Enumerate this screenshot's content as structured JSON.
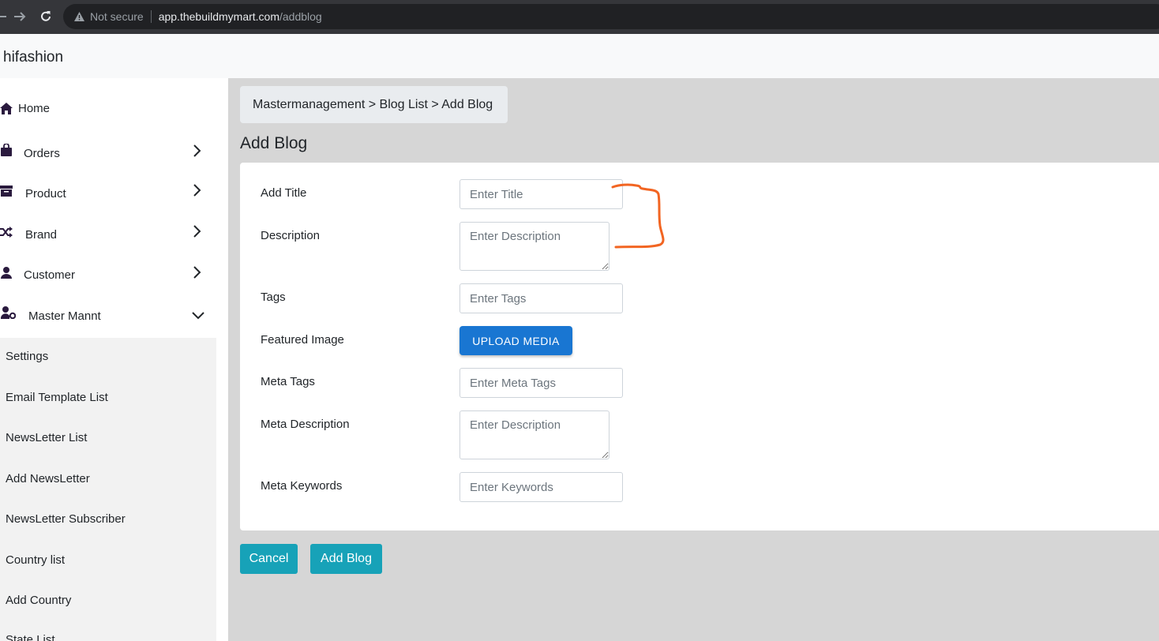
{
  "browser": {
    "security_label": "Not secure",
    "url_host": "app.thebuildmymart.com",
    "url_path": "/addblog"
  },
  "app": {
    "brand": "hifashion"
  },
  "sidebar": {
    "items": [
      {
        "label": "Home",
        "icon": "home-icon"
      },
      {
        "label": "Orders",
        "icon": "shopping-bag-icon"
      },
      {
        "label": "Product",
        "icon": "archive-box-icon"
      },
      {
        "label": "Brand",
        "icon": "shuffle-icon"
      },
      {
        "label": "Customer",
        "icon": "user-icon"
      },
      {
        "label": "Master Mannt",
        "icon": "user-gear-icon"
      }
    ],
    "submenu": [
      "Settings",
      "Email Template List",
      "NewsLetter List",
      "Add NewsLetter",
      "NewsLetter Subscriber",
      "Country list",
      "Add Country",
      "State List"
    ]
  },
  "breadcrumb": "Mastermanagement > Blog List > Add Blog",
  "page_title": "Add Blog",
  "form": {
    "title_label": "Add Title",
    "title_placeholder": "Enter Title",
    "description_label": "Description",
    "description_placeholder": "Enter Description",
    "tags_label": "Tags",
    "tags_placeholder": "Enter Tags",
    "featured_image_label": "Featured Image",
    "upload_label": "UPLOAD MEDIA",
    "meta_tags_label": "Meta Tags",
    "meta_tags_placeholder": "Enter Meta Tags",
    "meta_description_label": "Meta Description",
    "meta_description_placeholder": "Enter Description",
    "meta_keywords_label": "Meta Keywords",
    "meta_keywords_placeholder": "Enter Keywords"
  },
  "actions": {
    "cancel_label": "Cancel",
    "submit_label": "Add Blog"
  },
  "colors": {
    "primary_button": "#17a2b8",
    "upload_button": "#1976d2",
    "annotation": "#f26522",
    "sidebar_icon": "#2a1a3e"
  }
}
